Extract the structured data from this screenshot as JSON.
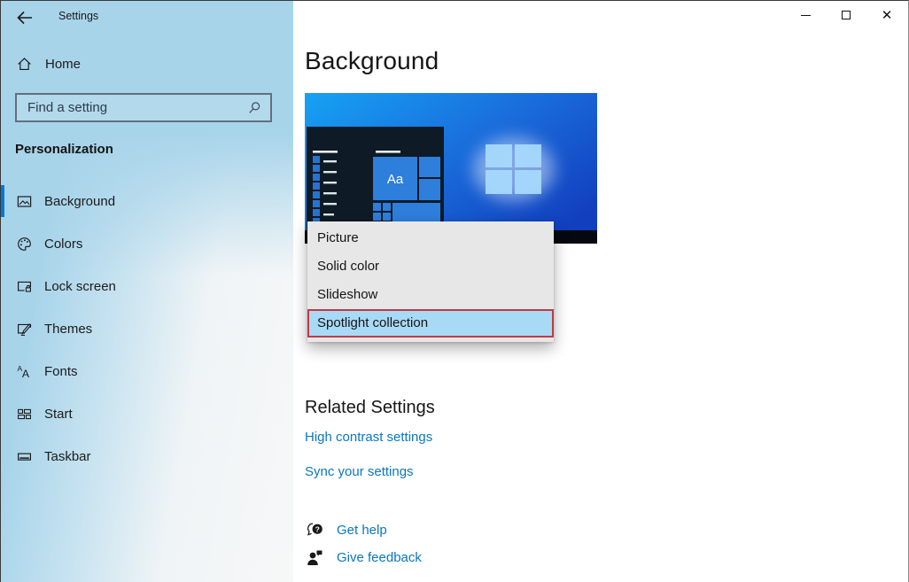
{
  "window": {
    "app_title": "Settings"
  },
  "sidebar": {
    "home_label": "Home",
    "search_placeholder": "Find a setting",
    "section_label": "Personalization",
    "nav": [
      {
        "label": "Background",
        "icon": "background-image-icon",
        "selected": true
      },
      {
        "label": "Colors",
        "icon": "palette-icon",
        "selected": false
      },
      {
        "label": "Lock screen",
        "icon": "lock-screen-icon",
        "selected": false
      },
      {
        "label": "Themes",
        "icon": "themes-icon",
        "selected": false
      },
      {
        "label": "Fonts",
        "icon": "fonts-icon",
        "selected": false
      },
      {
        "label": "Start",
        "icon": "start-tiles-icon",
        "selected": false
      },
      {
        "label": "Taskbar",
        "icon": "taskbar-icon",
        "selected": false
      }
    ]
  },
  "main": {
    "title": "Background",
    "preview": {
      "tile_text": "Aa"
    },
    "dropdown": {
      "options": [
        {
          "label": "Picture",
          "highlighted": false
        },
        {
          "label": "Solid color",
          "highlighted": false
        },
        {
          "label": "Slideshow",
          "highlighted": false
        },
        {
          "label": "Spotlight collection",
          "highlighted": true
        }
      ]
    },
    "related": {
      "heading": "Related Settings",
      "links": [
        "High contrast settings",
        "Sync your settings"
      ]
    },
    "help_links": [
      {
        "label": "Get help",
        "icon": "chat-question-icon"
      },
      {
        "label": "Give feedback",
        "icon": "person-feedback-icon"
      }
    ]
  },
  "colors": {
    "accent": "#0078d7",
    "link": "#0a77c0",
    "sidebar_blue": "#a8d4ea",
    "dropdown_bg": "#e7e7e7",
    "dropdown_highlight": "#a9daf5",
    "highlight_border_red": "#c13a45",
    "preview_sky_light": "#16a2f4",
    "preview_sky_dark": "#123fbe",
    "start_menu_dark": "#0e1b26",
    "tile_blue": "#2e7edc"
  }
}
